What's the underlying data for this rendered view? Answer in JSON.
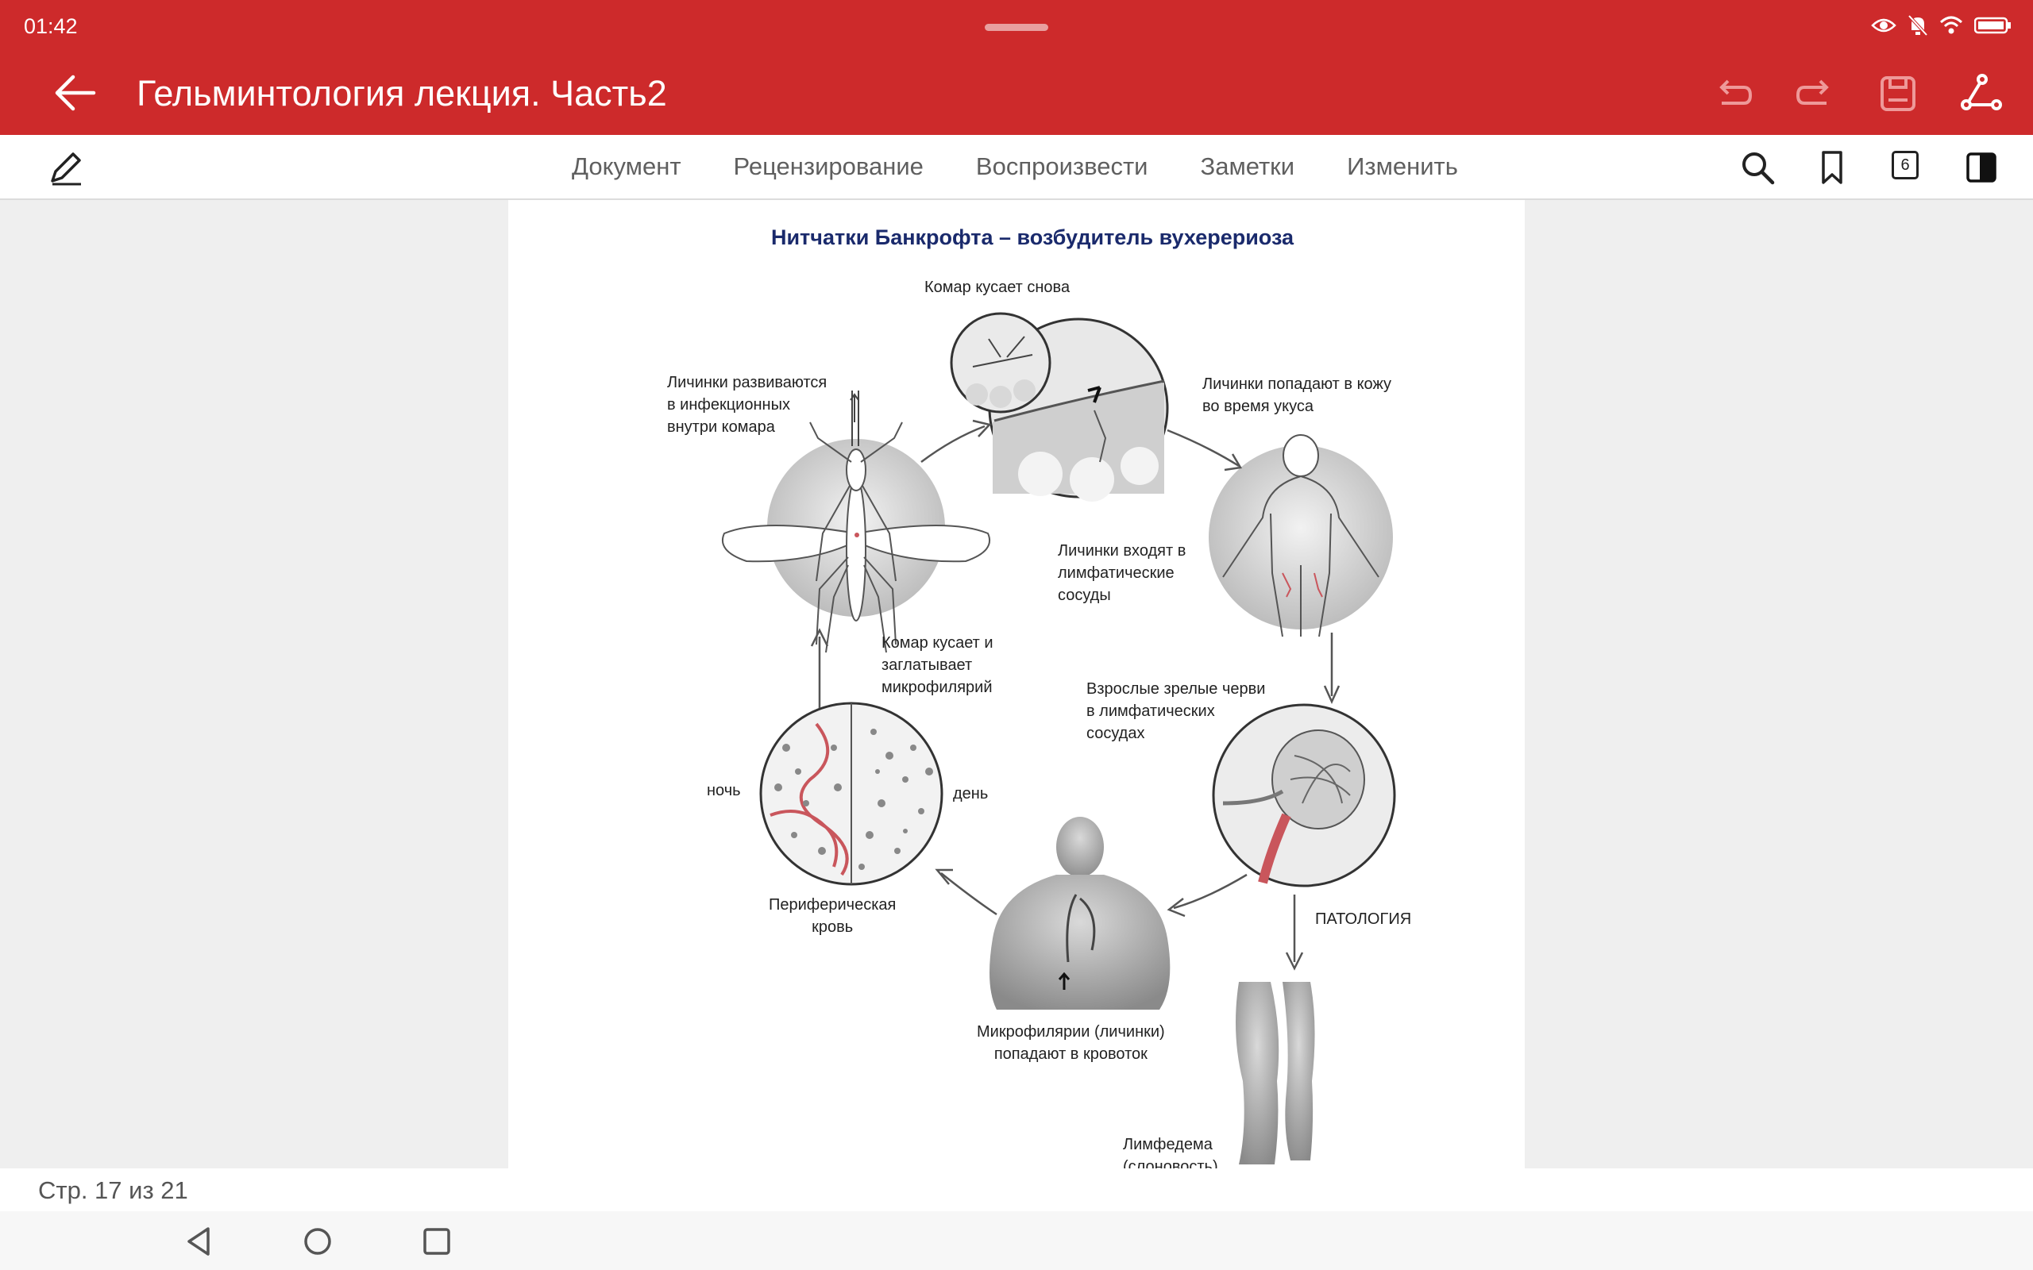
{
  "status": {
    "time": "01:42"
  },
  "header": {
    "title": "Гельминтология лекция. Часть2"
  },
  "tabs": [
    "Документ",
    "Рецензирование",
    "Воспроизвести",
    "Заметки",
    "Изменить"
  ],
  "page_count_badge": "6",
  "figure": {
    "title": "Нитчатки Банкрофта – возбудитель вухерериоза",
    "labels": {
      "mosquito_bites_again": "Комар кусает снова",
      "larvae_develop": [
        "Личинки развиваются",
        "в инфекционных",
        "внутри комара"
      ],
      "larvae_enter_skin": [
        "Личинки попадают в кожу",
        "во время укуса"
      ],
      "larvae_enter_lymph": [
        "Личинки входят в",
        "лимфатические",
        "сосуды"
      ],
      "mosquito_bites_swallows": [
        "Комар кусает и",
        "заглатывает",
        "микрофилярий"
      ],
      "adult_worms": [
        "Взрослые зрелые черви",
        "в лимфатических",
        "сосудах"
      ],
      "night": "ночь",
      "day": "день",
      "peripheral_blood": [
        "Периферическая",
        "кровь"
      ],
      "pathology": "ПАТОЛОГИЯ",
      "microfilariae_blood": [
        "Микрофилярии (личинки)",
        "попадают в кровоток"
      ],
      "lymphedema": [
        "Лимфедема",
        "(слоновость)"
      ]
    }
  },
  "footer": {
    "page_indicator": "Стр. 17 из 21"
  },
  "colors": {
    "accent": "#cd2a2b",
    "title_blue": "#1a2a6c",
    "worm_red": "#c9565c"
  }
}
